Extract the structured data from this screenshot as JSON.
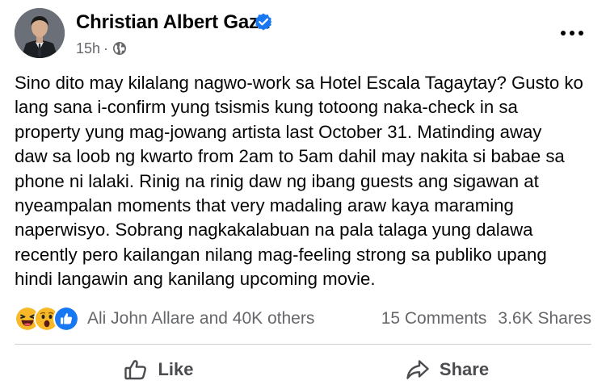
{
  "post": {
    "author": {
      "name": "Christian Albert Gaza",
      "verified": true
    },
    "meta": {
      "time": "15h",
      "separator": "·",
      "audience_icon": "globe-icon"
    },
    "more_icon": "more-options-icon",
    "text_lines": [
      "Sino dito may kilalang nagwo-work sa Hotel Escala Tagaytay? Gusto ko",
      "lang sana i-confirm yung tsismis kung totoong naka-check in sa",
      "property yung mag-jowang artista last October 31. Matinding away",
      "daw sa loob ng kwarto from 2am to 5am dahil may nakita si babae sa",
      "phone ni lalaki. Rinig na rinig daw ng ibang guests ang sigawan at",
      "nyeampalan moments that very madaling araw kaya maraming",
      "naperwisyo. Sobrang nagkakalabuan na pala talaga yung dalawa",
      "recently pero kailangan nilang mag-feeling strong sa publiko upang",
      "hindi langawin ang kanilang upcoming movie."
    ]
  },
  "engagement": {
    "reaction_icons": [
      "haha-icon",
      "wow-icon",
      "like-icon"
    ],
    "reactors": "Ali John Allare and 40K others",
    "comments": "15 Comments",
    "shares": "3.6K Shares"
  },
  "actions": {
    "like_label": "Like",
    "share_label": "Share"
  },
  "colors": {
    "text_primary": "#050505",
    "text_secondary": "#65676b",
    "verified_blue": "#1877f2",
    "action_text": "#4b4c4f",
    "divider": "#ced0d4",
    "reaction_yellow": "#f7b928",
    "like_blue": "#1877f2"
  }
}
